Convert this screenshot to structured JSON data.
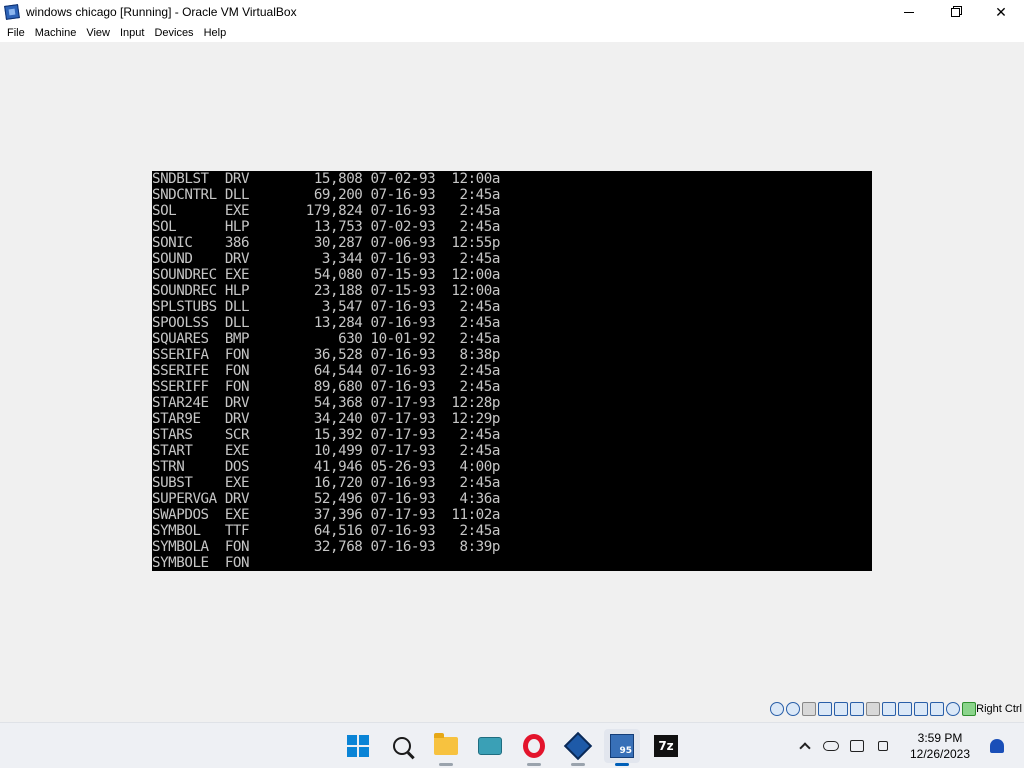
{
  "window": {
    "title": "windows chicago [Running] - Oracle VM VirtualBox",
    "controls": {
      "minimize": "",
      "maximize": "",
      "close": "✕"
    }
  },
  "menu": {
    "items": [
      "File",
      "Machine",
      "View",
      "Input",
      "Devices",
      "Help"
    ]
  },
  "vm": {
    "lines": [
      "SNDBLST  DRV        15,808 07-02-93  12:00a",
      "SNDCNTRL DLL        69,200 07-16-93   2:45a",
      "SOL      EXE       179,824 07-16-93   2:45a",
      "SOL      HLP        13,753 07-02-93   2:45a",
      "SONIC    386        30,287 07-06-93  12:55p",
      "SOUND    DRV         3,344 07-16-93   2:45a",
      "SOUNDREC EXE        54,080 07-15-93  12:00a",
      "SOUNDREC HLP        23,188 07-15-93  12:00a",
      "SPLSTUBS DLL         3,547 07-16-93   2:45a",
      "SPOOLSS  DLL        13,284 07-16-93   2:45a",
      "SQUARES  BMP           630 10-01-92   2:45a",
      "SSERIFA  FON        36,528 07-16-93   8:38p",
      "SSERIFE  FON        64,544 07-16-93   2:45a",
      "SSERIFF  FON        89,680 07-16-93   2:45a",
      "STAR24E  DRV        54,368 07-17-93  12:28p",
      "STAR9E   DRV        34,240 07-17-93  12:29p",
      "STARS    SCR        15,392 07-17-93   2:45a",
      "START    EXE        10,499 07-17-93   2:45a",
      "STRN     DOS        41,946 05-26-93   4:00p",
      "SUBST    EXE        16,720 07-16-93   2:45a",
      "SUPERVGA DRV        52,496 07-16-93   4:36a",
      "SWAPDOS  EXE        37,396 07-17-93  11:02a",
      "SYMBOL   TTF        64,516 07-16-93   2:45a",
      "SYMBOLA  FON        32,768 07-16-93   8:39p",
      "SYMBOLE  FON"
    ]
  },
  "statusbar": {
    "host_key": "Right Ctrl",
    "icons": [
      "hard-disk-icon",
      "optical-drive-icon",
      "floppy-icon",
      "network-icon",
      "network-icon",
      "usb-icon",
      "shared-folders-icon",
      "display-icon",
      "display-icon",
      "recording-icon",
      "cpu-icon",
      "arrow-icon",
      "mouse-integration-icon"
    ]
  },
  "taskbar": {
    "apps": [
      "start-icon",
      "search-icon",
      "file-explorer-icon",
      "touch-keyboard-icon",
      "opera-icon",
      "virtualbox-icon",
      "vm-windows95-icon",
      "7zip-icon"
    ],
    "vm95_badge": "95",
    "sevenzip_label": "7z",
    "clock_time": "3:59 PM",
    "clock_date": "12/26/2023"
  }
}
